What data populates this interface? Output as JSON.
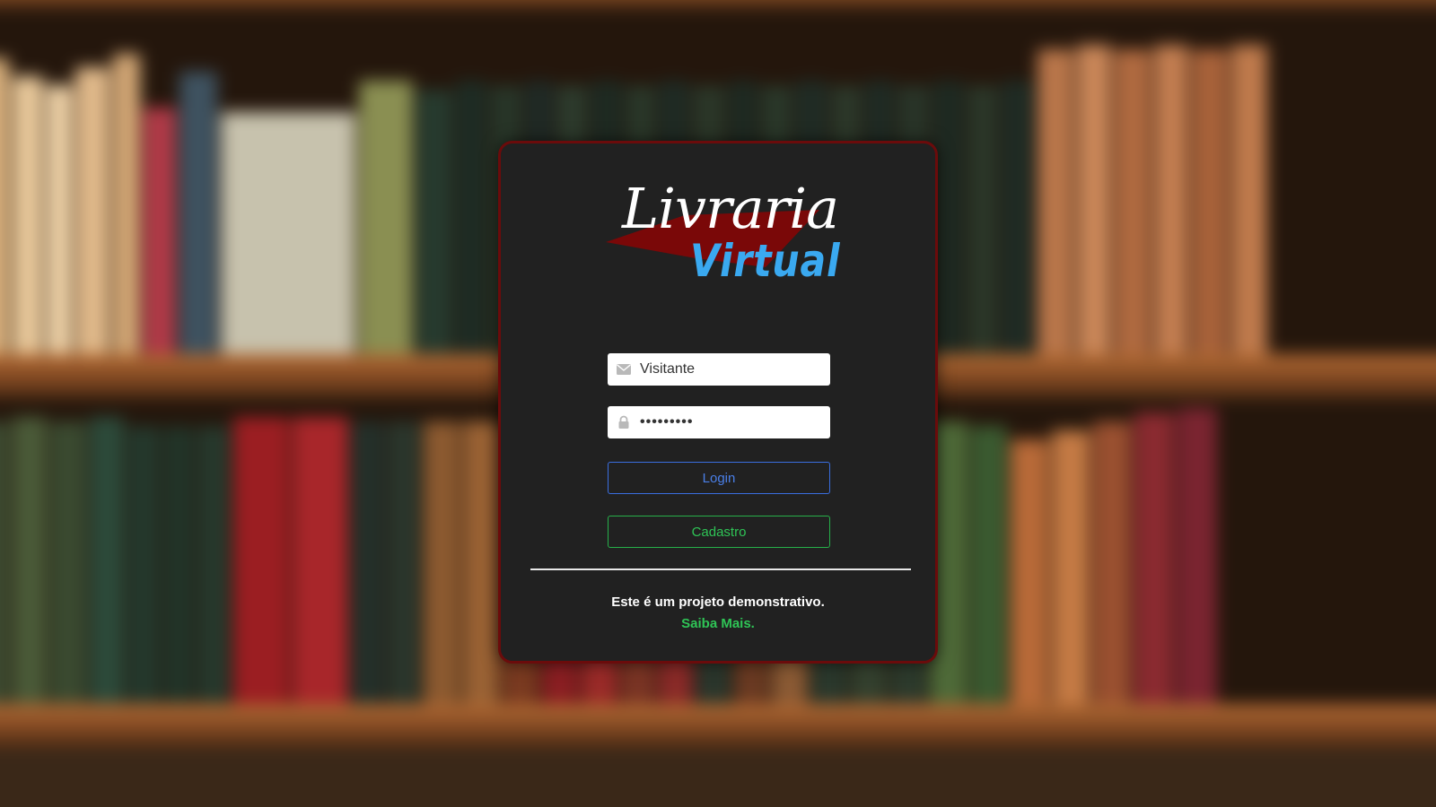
{
  "logo": {
    "script_text": "Livraria",
    "bold_text": "Virtual"
  },
  "login_form": {
    "email_value": "Visitante",
    "email_icon": "envelope-icon",
    "password_value": "•••••••••",
    "password_icon": "lock-icon",
    "login_label": "Login",
    "signup_label": "Cadastro"
  },
  "footer": {
    "note": "Este é um projeto demonstrativo.",
    "learn_more": "Saiba Mais."
  },
  "colors": {
    "card_bg": "#212121",
    "card_border": "#6b0b0b",
    "logo_accent": "#7a0808",
    "logo_blue": "#3aa9f0",
    "login_blue": "#3a6ee0",
    "signup_green": "#27b04a"
  }
}
